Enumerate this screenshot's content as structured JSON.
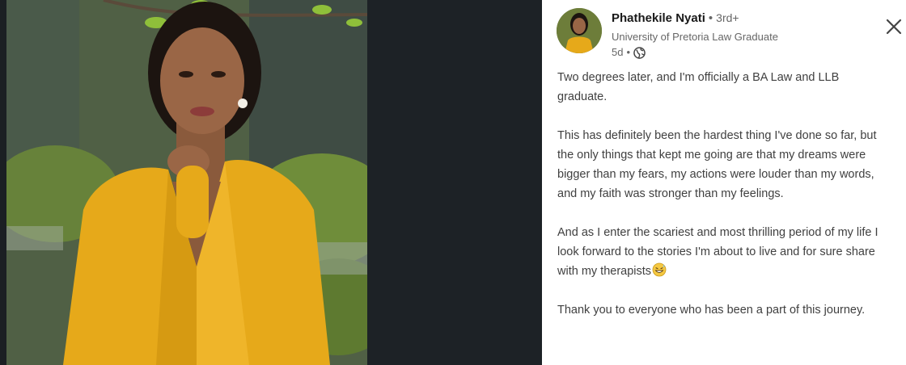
{
  "post": {
    "author": {
      "name": "Phathekile Nyati",
      "separator": "•",
      "degree": "3rd+",
      "headline": "University of Pretoria Law Graduate",
      "time": "5d",
      "time_separator": "•",
      "visibility_icon": "globe-icon"
    },
    "close_icon": "close-icon",
    "paragraphs": [
      "Two degrees later, and I'm officially a BA Law and LLB graduate.",
      "This has definitely been the hardest thing I've done so far, but the only things that kept me going are that my dreams were bigger than my fears, my actions were louder than my words, and my faith was stronger than my feelings.",
      "And as I enter the scariest and most thrilling period of my life I look forward to the stories I'm about to live and for sure share with my therapists",
      "Thank you to everyone who has been a part of this journey."
    ],
    "emoji": "grinning-sweat-emoji"
  },
  "colors": {
    "jacket": "#e6a91a",
    "text": "#404040",
    "muted": "#666666",
    "dark_bg": "#1d2226"
  }
}
